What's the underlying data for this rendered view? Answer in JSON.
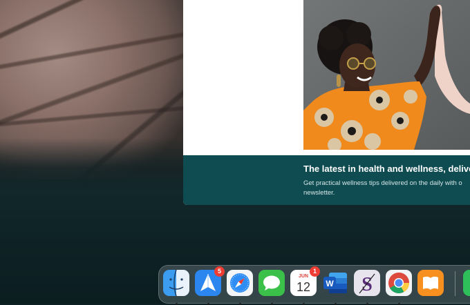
{
  "ad": {
    "headline": "The latest in health and wellness, delive",
    "subtext": "Get practical wellness tips delivered on the daily with o newsletter."
  },
  "dock": {
    "apps": [
      {
        "name": "Finder",
        "icon": "finder-icon",
        "running": true,
        "badge": ""
      },
      {
        "name": "Spark",
        "icon": "paper-plane-icon",
        "running": true,
        "badge": "5"
      },
      {
        "name": "Safari",
        "icon": "compass-icon",
        "running": true,
        "badge": ""
      },
      {
        "name": "Messages",
        "icon": "chat-bubble-icon",
        "running": true,
        "badge": ""
      },
      {
        "name": "Calendar",
        "icon": "calendar-icon",
        "running": true,
        "badge": "1",
        "month": "JUN",
        "day": "12"
      },
      {
        "name": "Microsoft Word",
        "icon": "word-icon",
        "running": true,
        "badge": "",
        "letter": "W"
      },
      {
        "name": "Scrivener",
        "icon": "scrivener-icon",
        "running": true,
        "badge": "",
        "letter": "S"
      },
      {
        "name": "Google Chrome",
        "icon": "chrome-icon",
        "running": true,
        "badge": ""
      },
      {
        "name": "Books",
        "icon": "book-icon",
        "running": false,
        "badge": ""
      }
    ]
  },
  "colors": {
    "banner_bg": "#0e4c52",
    "badge_red": "#ef3d33"
  }
}
